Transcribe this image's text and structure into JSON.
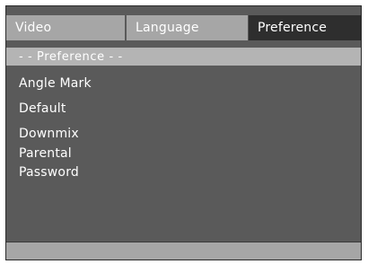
{
  "tabs": [
    {
      "label": "Video"
    },
    {
      "label": "Language"
    },
    {
      "label": "Preference"
    }
  ],
  "section_header": "- -  Preference  - -",
  "menu": {
    "items": [
      {
        "label": "Angle Mark"
      },
      {
        "label": "Default"
      },
      {
        "label": "Downmix"
      },
      {
        "label": "Parental"
      },
      {
        "label": "Password"
      }
    ]
  },
  "colors": {
    "panel_bg": "#5a5a5a",
    "tab_inactive": "#a6a6a6",
    "tab_active": "#2e2e2e",
    "header_bar": "#b4b4b4",
    "text": "#ffffff"
  }
}
